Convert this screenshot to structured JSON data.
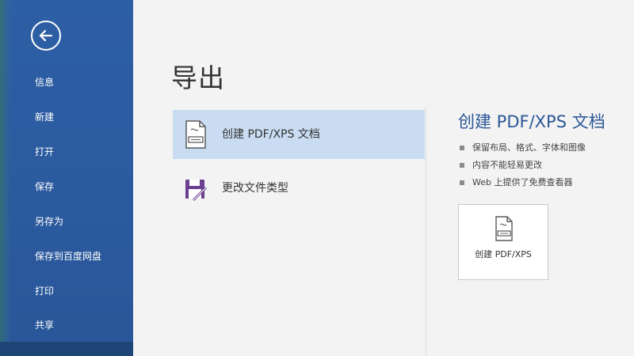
{
  "sidebar": {
    "items": [
      {
        "label": "信息"
      },
      {
        "label": "新建"
      },
      {
        "label": "打开"
      },
      {
        "label": "保存"
      },
      {
        "label": "另存为"
      },
      {
        "label": "保存到百度网盘"
      },
      {
        "label": "打印"
      },
      {
        "label": "共享"
      },
      {
        "label": ""
      }
    ]
  },
  "main": {
    "title": "导出",
    "options": [
      {
        "label": "创建 PDF/XPS 文档",
        "icon": "pdf-document-icon",
        "selected": true
      },
      {
        "label": "更改文件类型",
        "icon": "change-file-type-icon",
        "selected": false
      }
    ],
    "detail": {
      "title": "创建 PDF/XPS 文档",
      "bullets": [
        "保留布局、格式、字体和图像",
        "内容不能轻易更改",
        "Web 上提供了免费查看器"
      ],
      "button_label": "创建 PDF/XPS"
    }
  },
  "colors": {
    "sidebar": "#2b5797",
    "accent": "#2b5797",
    "selected": "#c9dcf2",
    "background": "#f3f3f3"
  }
}
